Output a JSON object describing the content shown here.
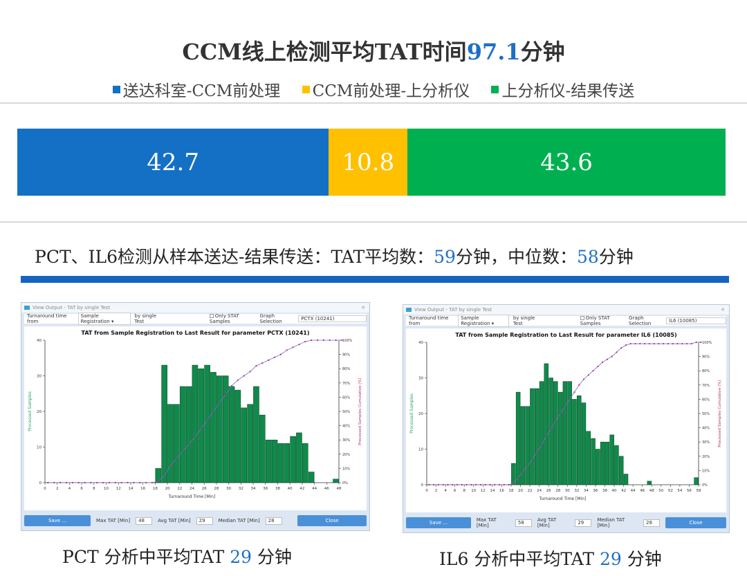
{
  "header": {
    "title_prefix": "CCM线上检测平均TAT时间",
    "title_value": "97.1",
    "title_suffix": "分钟"
  },
  "legend": [
    {
      "label": "送达科室-CCM前处理",
      "color": "#1470c5"
    },
    {
      "label": "CCM前处理-上分析仪",
      "color": "#ffc000"
    },
    {
      "label": "上分析仪-结果传送",
      "color": "#00b050"
    }
  ],
  "stacked": [
    {
      "value": "42.7",
      "num": 42.7,
      "color": "#1470c5"
    },
    {
      "value": "10.8",
      "num": 10.8,
      "color": "#ffc000"
    },
    {
      "value": "43.6",
      "num": 43.6,
      "color": "#00b050"
    }
  ],
  "subline": {
    "prefix": "PCT、IL6检测从样本送达-结果传送：TAT平均数：",
    "mean": "59",
    "mid": "分钟，中位数：",
    "median": "58",
    "suffix": "分钟"
  },
  "windows": [
    {
      "window_title": "View Output - TAT by single Test",
      "tat_from_label": "Turnaround time from",
      "tat_from_value": "Sample Registration",
      "by_label": "by single Test",
      "stat_label": "Only STAT Samples",
      "graph_sel_label": "Graph Selection",
      "graph_sel_value": "PCTX (10241)",
      "save_label": "Save ...",
      "max_label": "Max TAT [Min]",
      "max_value": "48",
      "avg_label": "Avg TAT [Min]",
      "avg_value": "29",
      "median_label": "Median TAT [Min]",
      "median_value": "28",
      "close_label": "Close",
      "caption_prefix": "PCT 分析中平均TAT ",
      "caption_value": "29",
      "caption_suffix": " 分钟"
    },
    {
      "window_title": "View Output - TAT by single Test",
      "tat_from_label": "Turnaround time from",
      "tat_from_value": "Sample Registration",
      "by_label": "by single Test",
      "stat_label": "Only STAT Samples",
      "graph_sel_label": "Graph Selection",
      "graph_sel_value": "IL6 (10085)",
      "save_label": "Save ...",
      "max_label": "Max TAT [Min]",
      "max_value": "58",
      "avg_label": "Avg TAT [Min]",
      "avg_value": "29",
      "median_label": "Median TAT [Min]",
      "median_value": "28",
      "close_label": "Close",
      "caption_prefix": "IL6 分析中平均TAT ",
      "caption_value": "29",
      "caption_suffix": " 分钟"
    }
  ],
  "chart_data": [
    {
      "type": "bar",
      "title": "TAT from Sample Registration to Last Result for parameter PCTX (10241)",
      "xlabel": "Turnaround Time [Min]",
      "ylabel": "Processed Samples",
      "y2label": "Processed Samples Cumulative (%)",
      "xlim": [
        0,
        48
      ],
      "ylim": [
        0,
        40
      ],
      "xticks": [
        0,
        2,
        4,
        6,
        8,
        10,
        12,
        14,
        16,
        18,
        20,
        22,
        24,
        26,
        28,
        30,
        32,
        34,
        36,
        38,
        40,
        42,
        44,
        46,
        48
      ],
      "yticks": [
        0,
        10,
        20,
        30,
        40
      ],
      "y2ticks": [
        "0%",
        "10%",
        "20%",
        "30%",
        "40%",
        "50%",
        "60%",
        "70%",
        "80%",
        "90%",
        "100%"
      ],
      "bar_x": [
        18,
        19,
        20,
        21,
        22,
        23,
        24,
        25,
        26,
        27,
        28,
        29,
        30,
        31,
        32,
        33,
        34,
        35,
        36,
        37,
        38,
        39,
        40,
        41,
        42,
        43,
        47
      ],
      "bar_values": [
        4,
        33,
        22,
        22,
        27,
        27,
        33,
        32,
        33,
        31,
        30,
        30,
        27,
        26,
        21,
        22,
        27,
        19,
        12,
        12,
        11,
        11,
        13,
        14,
        11,
        3,
        1
      ],
      "cumulative_x": [
        0,
        1,
        2,
        3,
        4,
        5,
        6,
        7,
        8,
        9,
        10,
        11,
        12,
        13,
        14,
        15,
        16,
        17,
        18,
        19,
        20,
        21,
        22,
        23,
        24,
        25,
        26,
        27,
        28,
        29,
        30,
        31,
        32,
        33,
        34,
        35,
        36,
        37,
        38,
        39,
        40,
        41,
        42,
        43,
        44,
        45,
        46,
        47,
        48
      ],
      "cumulative_pct": [
        0,
        0,
        0,
        0,
        0,
        0,
        0,
        0,
        0,
        0,
        0,
        0,
        0,
        0,
        0,
        0,
        0,
        0,
        1,
        5,
        12,
        17,
        22,
        27,
        32,
        38,
        44,
        50,
        56,
        62,
        68,
        72,
        75,
        78,
        82,
        84,
        86,
        88,
        90,
        93,
        95,
        97,
        99,
        100,
        100,
        100,
        100,
        100,
        100
      ]
    },
    {
      "type": "bar",
      "title": "TAT from Sample Registration to Last Result for parameter IL6 (10085)",
      "xlabel": "Turnaround Time [Min]",
      "ylabel": "Processed Samples",
      "y2label": "Processed Samples Cumulative (%)",
      "xlim": [
        0,
        58
      ],
      "ylim": [
        0,
        40
      ],
      "xticks": [
        0,
        2,
        4,
        6,
        8,
        10,
        12,
        14,
        16,
        18,
        20,
        22,
        24,
        26,
        28,
        30,
        32,
        34,
        36,
        38,
        40,
        42,
        44,
        46,
        48,
        50,
        52,
        54,
        56,
        58
      ],
      "yticks": [
        0,
        10,
        20,
        30,
        40
      ],
      "y2ticks": [
        "0%",
        "10%",
        "20%",
        "30%",
        "40%",
        "50%",
        "60%",
        "70%",
        "80%",
        "90%",
        "100%"
      ],
      "bar_x": [
        18,
        19,
        20,
        21,
        22,
        23,
        24,
        25,
        26,
        27,
        28,
        29,
        30,
        31,
        32,
        33,
        34,
        35,
        36,
        37,
        38,
        39,
        40,
        41,
        42,
        43,
        47,
        57
      ],
      "bar_values": [
        6,
        26,
        22,
        22,
        27,
        27,
        29,
        34,
        30,
        29,
        26,
        29,
        29,
        24,
        25,
        23,
        15,
        13,
        10,
        12,
        12,
        14,
        11,
        8,
        3,
        0,
        1,
        2
      ],
      "cumulative_x": [
        0,
        1,
        2,
        3,
        4,
        5,
        6,
        7,
        8,
        9,
        10,
        11,
        12,
        13,
        14,
        15,
        16,
        17,
        18,
        19,
        20,
        21,
        22,
        23,
        24,
        25,
        26,
        27,
        28,
        29,
        30,
        31,
        32,
        33,
        34,
        35,
        36,
        37,
        38,
        39,
        40,
        41,
        42,
        43,
        44,
        45,
        46,
        47,
        48,
        49,
        50,
        51,
        52,
        53,
        54,
        55,
        56,
        57,
        58
      ],
      "cumulative_pct": [
        0,
        0,
        0,
        0,
        0,
        0,
        0,
        0,
        0,
        0,
        0,
        0,
        0,
        0,
        0,
        0,
        0,
        0,
        1,
        5,
        9,
        13,
        18,
        23,
        28,
        34,
        39,
        45,
        50,
        55,
        60,
        65,
        70,
        74,
        77,
        80,
        83,
        86,
        88,
        90,
        93,
        96,
        98,
        99,
        99,
        99,
        99,
        99,
        99,
        99,
        99,
        99,
        99,
        99,
        99,
        99,
        99,
        100,
        100
      ]
    }
  ]
}
